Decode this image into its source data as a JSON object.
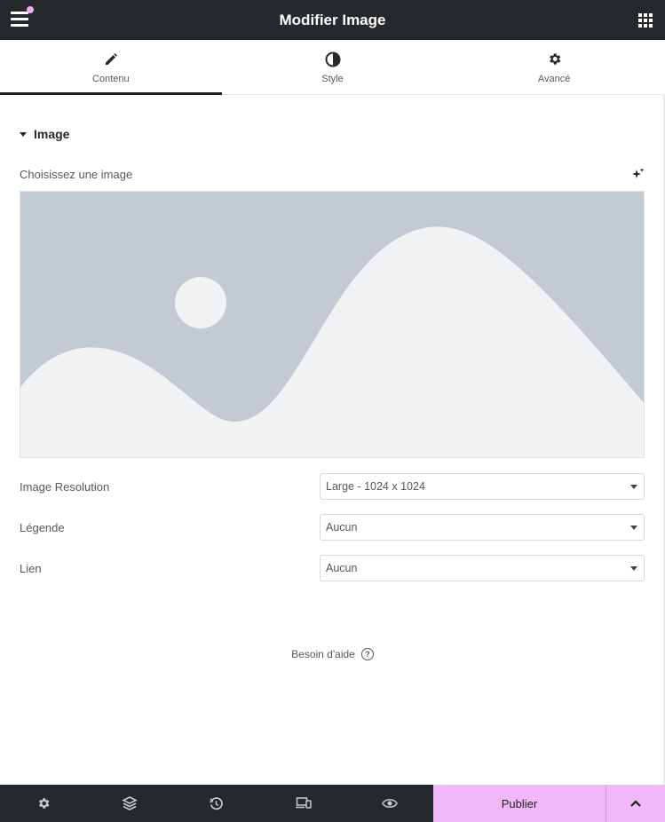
{
  "header": {
    "title": "Modifier Image",
    "menu_icon": "hamburger-icon",
    "apps_icon": "grid-icon",
    "notification_color": "#f0abfc"
  },
  "tabs": [
    {
      "label": "Contenu",
      "icon": "pencil-icon",
      "active": true
    },
    {
      "label": "Style",
      "icon": "half-circle-icon",
      "active": false
    },
    {
      "label": "Avancé",
      "icon": "gear-icon",
      "active": false
    }
  ],
  "section": {
    "title": "Image",
    "choose_label": "Choisissez une image",
    "ai_icon": "sparkle-icon"
  },
  "fields": [
    {
      "label": "Image Resolution",
      "value": "Large - 1024 x 1024"
    },
    {
      "label": "Légende",
      "value": "Aucun"
    },
    {
      "label": "Lien",
      "value": "Aucun"
    }
  ],
  "help": {
    "label": "Besoin d'aide"
  },
  "footer": {
    "publish_label": "Publier",
    "accent_color": "#f0b8f9",
    "icons": [
      "gear-icon",
      "layers-icon",
      "history-icon",
      "responsive-icon",
      "eye-icon",
      "chevron-up-icon"
    ]
  }
}
